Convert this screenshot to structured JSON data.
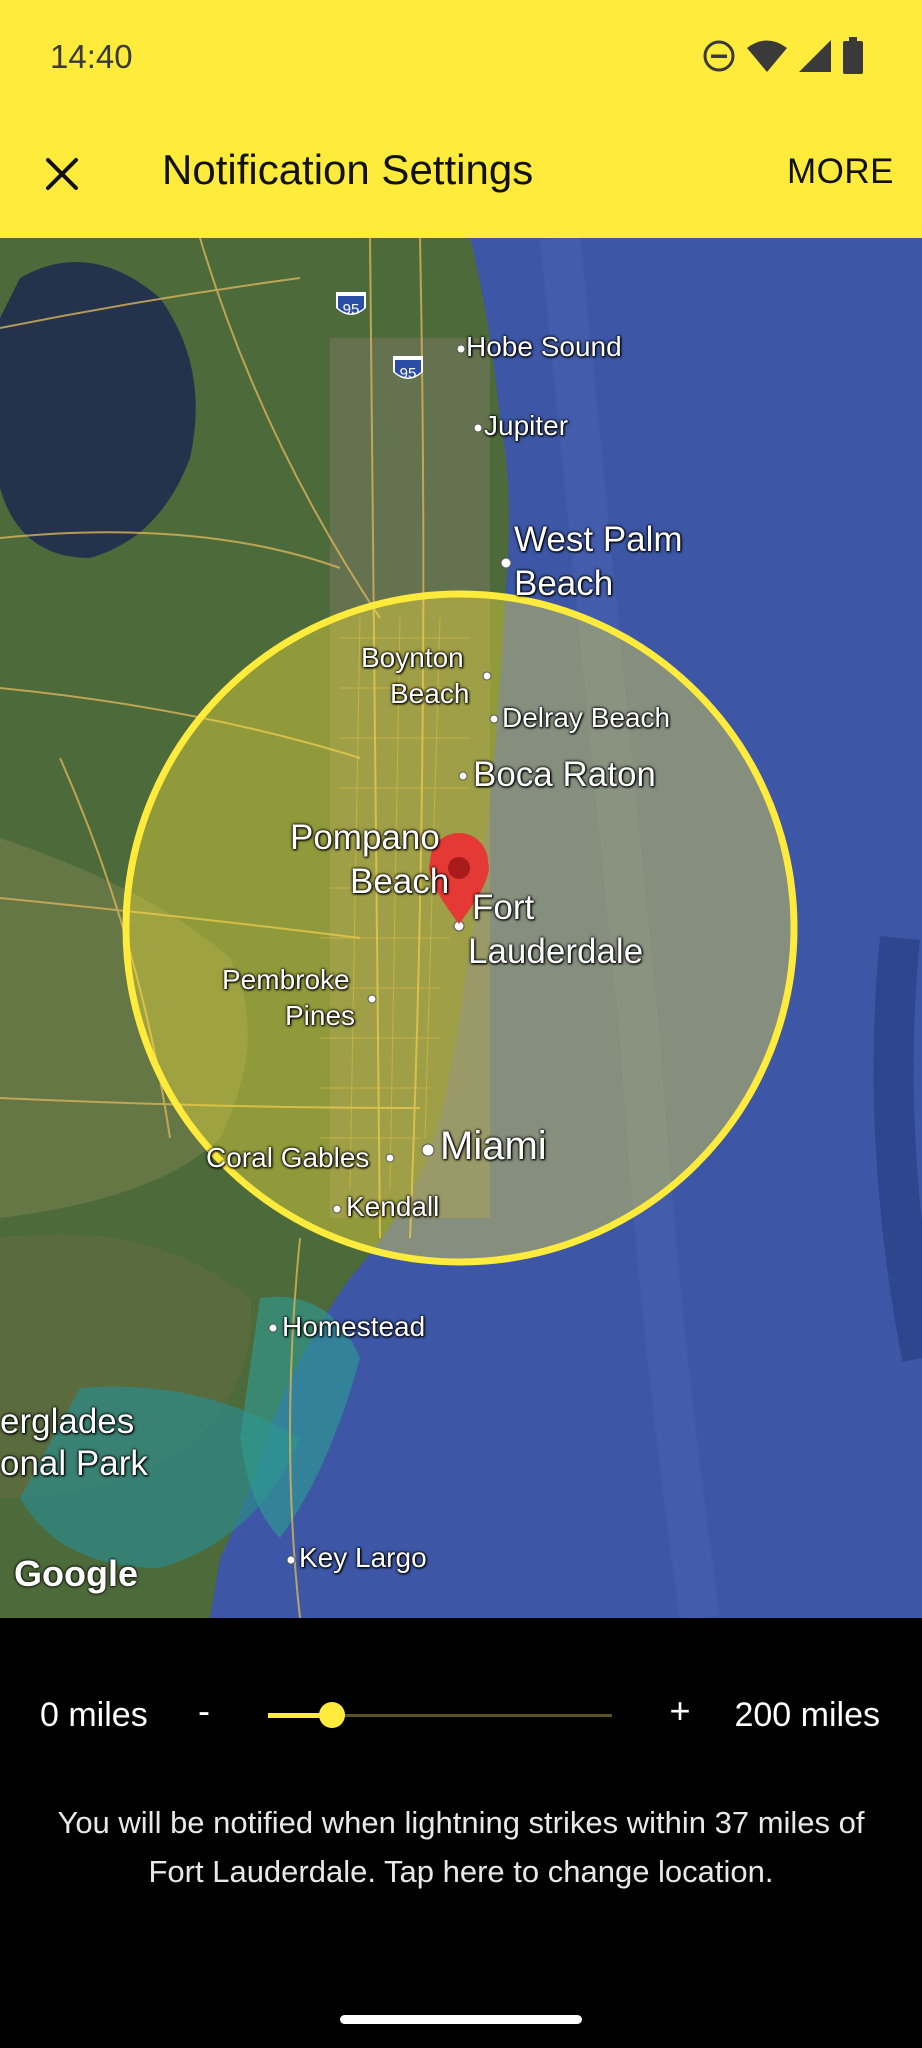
{
  "status_bar": {
    "time": "14:40",
    "icons": [
      "do-not-disturb-icon",
      "wifi-icon",
      "cellular-signal-icon",
      "battery-icon"
    ]
  },
  "app_bar": {
    "close_icon": "close-icon",
    "title": "Notification Settings",
    "more_label": "MORE",
    "background_color": "#ffeb3b"
  },
  "map": {
    "labels": {
      "hobe_sound": "Hobe Sound",
      "jupiter": "Jupiter",
      "west_palm_beach_1": "West Palm",
      "west_palm_beach_2": "Beach",
      "boynton_beach_1": "Boynton",
      "boynton_beach_2": "Beach",
      "delray_beach": "Delray Beach",
      "boca_raton": "Boca Raton",
      "pompano_beach_1": "Pompano",
      "pompano_beach_2": "Beach",
      "fort_lauderdale_1": "Fort",
      "fort_lauderdale_2": "Lauderdale",
      "pembroke_pines_1": "Pembroke",
      "pembroke_pines_2": "Pines",
      "coral_gables": "Coral Gables",
      "miami": "Miami",
      "kendall": "Kendall",
      "homestead": "Homestead",
      "everglades_1": "erglades",
      "everglades_2": "onal Park",
      "key_largo": "Key Largo"
    },
    "highway_shield": "95",
    "attribution": "Google",
    "marker_icon": "map-pin-icon",
    "radius_circle_color": "#ffeb3b"
  },
  "radius": {
    "min_label": "0 miles",
    "max_label": "200 miles",
    "minus_label": "-",
    "plus_label": "+",
    "value_miles": 37,
    "min_miles": 0,
    "max_miles": 200
  },
  "notification_text": "You will be notified when lightning strikes within 37 miles of Fort Lauderdale. Tap here to change location."
}
